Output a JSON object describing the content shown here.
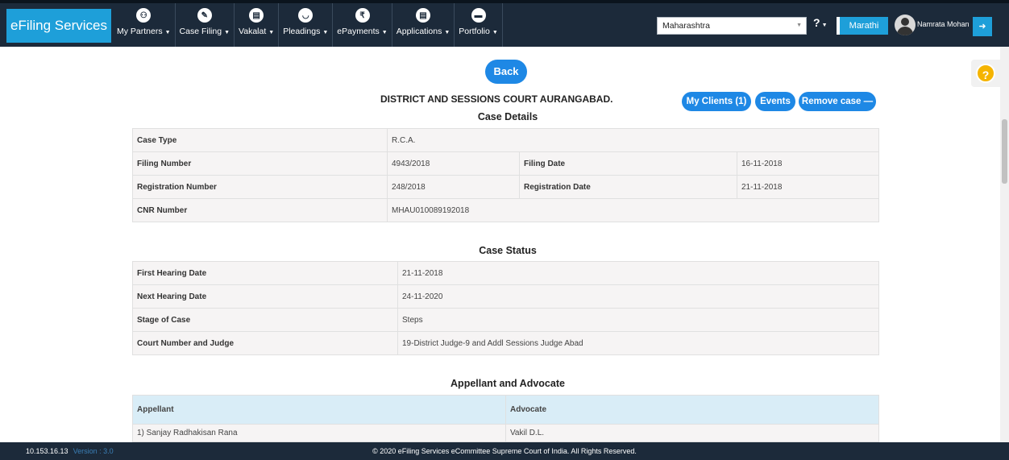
{
  "navbar": {
    "brand": "eFiling Services",
    "menu": [
      {
        "label": "My Partners",
        "icon": "partners-icon",
        "glyph": "⚇"
      },
      {
        "label": "Case Filing",
        "icon": "pencil-icon",
        "glyph": "✎"
      },
      {
        "label": "Vakalat",
        "icon": "document-icon",
        "glyph": "▤"
      },
      {
        "label": "Pleadings",
        "icon": "hands-icon",
        "glyph": "◡"
      },
      {
        "label": "ePayments",
        "icon": "rupee-icon",
        "glyph": "₹"
      },
      {
        "label": "Applications",
        "icon": "file-icon",
        "glyph": "▤"
      },
      {
        "label": "Portfolio",
        "icon": "briefcase-icon",
        "glyph": "▬"
      }
    ],
    "state_select": "Maharashtra",
    "help": "?",
    "language_button": "Marathi",
    "user_name": "Namrata Mohan..."
  },
  "page": {
    "back_label": "Back",
    "court_title": "DISTRICT AND SESSIONS COURT AURANGABAD.",
    "actions": {
      "my_clients": "My Clients (1)",
      "events": "Events",
      "remove_case": "Remove case —"
    },
    "case_details": {
      "title": "Case Details",
      "case_type_label": "Case Type",
      "case_type": "R.C.A.",
      "filing_number_label": "Filing Number",
      "filing_number": "4943/2018",
      "filing_date_label": "Filing Date",
      "filing_date": "16-11-2018",
      "registration_number_label": "Registration Number",
      "registration_number": "248/2018",
      "registration_date_label": "Registration Date",
      "registration_date": "21-11-2018",
      "cnr_label": "CNR Number",
      "cnr": "MHAU010089192018"
    },
    "case_status": {
      "title": "Case Status",
      "rows": [
        {
          "label": "First Hearing Date",
          "value": "21-11-2018"
        },
        {
          "label": "Next Hearing Date",
          "value": "24-11-2020"
        },
        {
          "label": "Stage of Case",
          "value": "Steps"
        },
        {
          "label": "Court Number and Judge",
          "value": "19-District Judge-9 and Addl Sessions Judge Abad"
        }
      ]
    },
    "appellant": {
      "title": "Appellant and Advocate",
      "col_appellant": "Appellant",
      "col_advocate": "Advocate",
      "rows": [
        {
          "appellant": "1) Sanjay Radhakisan Rana",
          "advocate": "Vakil D.L."
        }
      ]
    }
  },
  "footer": {
    "ip": "10.153.16.13",
    "version": "Version : 3.0",
    "copyright": "© 2020 eFiling Services eCommittee Supreme Court of India. All Rights Reserved."
  }
}
